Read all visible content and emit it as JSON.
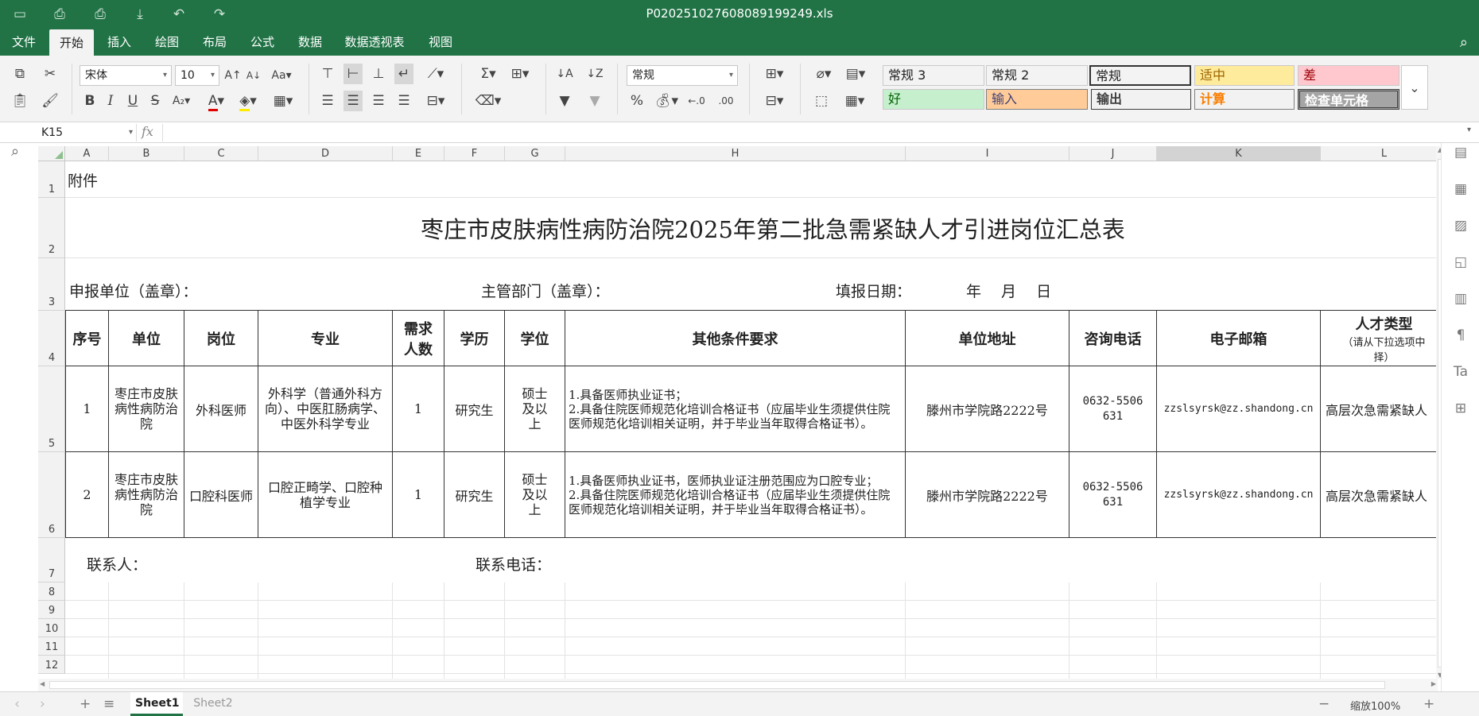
{
  "app": {
    "filename": "P020251027608089199249.xls"
  },
  "menu": [
    "文件",
    "开始",
    "插入",
    "绘图",
    "布局",
    "公式",
    "数据",
    "数据透视表",
    "视图"
  ],
  "ribbon": {
    "font_name": "宋体",
    "font_size": "10",
    "number_format": "常规",
    "styles": [
      {
        "label": "常规 3",
        "bg": "#ffffff",
        "fg": "#222222"
      },
      {
        "label": "常规 2",
        "bg": "#ffffff",
        "fg": "#222222"
      },
      {
        "label": "常规",
        "bg": "#ffffff",
        "fg": "#222222"
      },
      {
        "label": "适中",
        "bg": "#ffeb9c",
        "fg": "#9c6500"
      },
      {
        "label": "差",
        "bg": "#ffc7ce",
        "fg": "#9c0006"
      },
      {
        "label": "好",
        "bg": "#c6efce",
        "fg": "#006100"
      },
      {
        "label": "输入",
        "bg": "#ffcc99",
        "fg": "#3f3f76"
      },
      {
        "label": "输出",
        "bg": "#f2f2f2",
        "fg": "#3f3f3f"
      },
      {
        "label": "计算",
        "bg": "#f2f2f2",
        "fg": "#fa7d00"
      },
      {
        "label": "检查单元格",
        "bg": "#a5a5a5",
        "fg": "#ffffff"
      }
    ]
  },
  "formula_bar": {
    "name_box": "K15",
    "fx": "fx",
    "formula": ""
  },
  "columns": [
    "A",
    "B",
    "C",
    "D",
    "E",
    "F",
    "G",
    "H",
    "I",
    "J",
    "K",
    "L"
  ],
  "rows": [
    "1",
    "2",
    "3",
    "4",
    "5",
    "6",
    "7",
    "8",
    "9",
    "10",
    "11",
    "12"
  ],
  "sheet": {
    "a1": "附件",
    "title": "枣庄市皮肤病性病防治院2025年第二批急需紧缺人才引进岗位汇总表",
    "unit_label": "申报单位（盖章）：",
    "dept_label": "主管部门（盖章）：",
    "date_label": "填报日期：",
    "date_value": "年　 月　 日",
    "headers": {
      "seq": "序号",
      "unit": "单位",
      "post": "岗位",
      "major": "专业",
      "count1": "需求",
      "count2": "人数",
      "edu": "学历",
      "degree": "学位",
      "other": "其他条件要求",
      "address": "单位地址",
      "phone": "咨询电话",
      "email": "电子邮箱",
      "type": "人才类型",
      "type_note": "（请从下拉选项中",
      "type_note2": "择）"
    },
    "rows": [
      {
        "seq": "1",
        "unit": "枣庄市皮肤病性病防治院",
        "post": "外科医师",
        "major": "外科学（普通外科方向）、中医肛肠病学、中医外科学专业",
        "count": "1",
        "edu": "研究生",
        "degree": "硕士及以上",
        "other1": "1.具备医师执业证书；",
        "other2": "2.具备住院医师规范化培训合格证书（应届毕业生须提供住院医师规范化培训相关证明，并于毕业当年取得合格证书）。",
        "address": "滕州市学院路2222号",
        "phone": "0632-5506631",
        "email": "zzslsyrsk@zz.shandong.cn",
        "type": "高层次急需紧缺人"
      },
      {
        "seq": "2",
        "unit": "枣庄市皮肤病性病防治院",
        "post": "口腔科医师",
        "major": "口腔正畸学、口腔种植学专业",
        "count": "1",
        "edu": "研究生",
        "degree": "硕士及以上",
        "other1": "1.具备医师执业证书，医师执业证注册范围应为口腔专业；",
        "other2": "2.具备住院医师规范化培训合格证书（应届毕业生须提供住院医师规范化培训相关证明，并于毕业当年取得合格证书）。",
        "address": "滕州市学院路2222号",
        "phone": "0632-5506631",
        "email": "zzslsyrsk@zz.shandong.cn",
        "type": "高层次急需紧缺人"
      }
    ],
    "contact_label": "联系人：",
    "contact_phone_label": "联系电话："
  },
  "tabs": [
    "Sheet1",
    "Sheet2"
  ],
  "zoom": "缩放100%"
}
